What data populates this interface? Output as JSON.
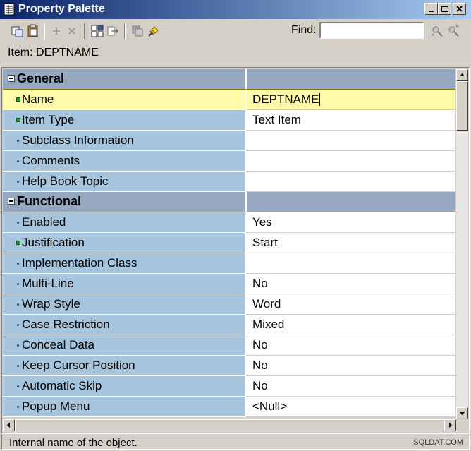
{
  "window": {
    "title": "Property Palette",
    "controls": {
      "minimize": "minimize-icon",
      "maximize": "maximize-icon",
      "close": "close-icon"
    }
  },
  "toolbar": {
    "icons": [
      "copy-properties-icon",
      "paste-properties-icon",
      "add-property-icon",
      "delete-property-icon",
      "property-class-icon",
      "inherit-icon",
      "intersection-union-icon",
      "freeze-icon",
      "find-previous-icon",
      "find-next-icon"
    ],
    "find_label": "Find:",
    "find_value": ""
  },
  "item_label": "Item: DEPTNAME",
  "rows": [
    {
      "type": "section",
      "name": "General"
    },
    {
      "type": "prop",
      "name": "Name",
      "value": "DEPTNAME",
      "bullet": "square",
      "selected": true
    },
    {
      "type": "prop",
      "name": "Item Type",
      "value": "Text Item",
      "bullet": "square"
    },
    {
      "type": "prop",
      "name": "Subclass Information",
      "value": "",
      "bullet": "dot"
    },
    {
      "type": "prop",
      "name": "Comments",
      "value": "",
      "bullet": "dot"
    },
    {
      "type": "prop",
      "name": "Help Book Topic",
      "value": "",
      "bullet": "dot"
    },
    {
      "type": "section",
      "name": "Functional"
    },
    {
      "type": "prop",
      "name": "Enabled",
      "value": "Yes",
      "bullet": "dot"
    },
    {
      "type": "prop",
      "name": "Justification",
      "value": "Start",
      "bullet": "square"
    },
    {
      "type": "prop",
      "name": "Implementation Class",
      "value": "",
      "bullet": "dot"
    },
    {
      "type": "prop",
      "name": "Multi-Line",
      "value": "No",
      "bullet": "dot"
    },
    {
      "type": "prop",
      "name": "Wrap Style",
      "value": "Word",
      "bullet": "dot"
    },
    {
      "type": "prop",
      "name": "Case Restriction",
      "value": "Mixed",
      "bullet": "dot"
    },
    {
      "type": "prop",
      "name": "Conceal Data",
      "value": "No",
      "bullet": "dot"
    },
    {
      "type": "prop",
      "name": "Keep Cursor Position",
      "value": "No",
      "bullet": "dot"
    },
    {
      "type": "prop",
      "name": "Automatic Skip",
      "value": "No",
      "bullet": "dot"
    },
    {
      "type": "prop",
      "name": "Popup Menu",
      "value": "<Null>",
      "bullet": "dot"
    }
  ],
  "status": {
    "text": "Internal name of the object.",
    "watermark": "SQLDAT.COM"
  },
  "colors": {
    "section": "#96a8bf",
    "name_cell": "#a6c4dc",
    "selected": "#fffba8",
    "title_start": "#0a246a",
    "title_end": "#a6caf0",
    "bullet_modified": "#2ea02e"
  }
}
